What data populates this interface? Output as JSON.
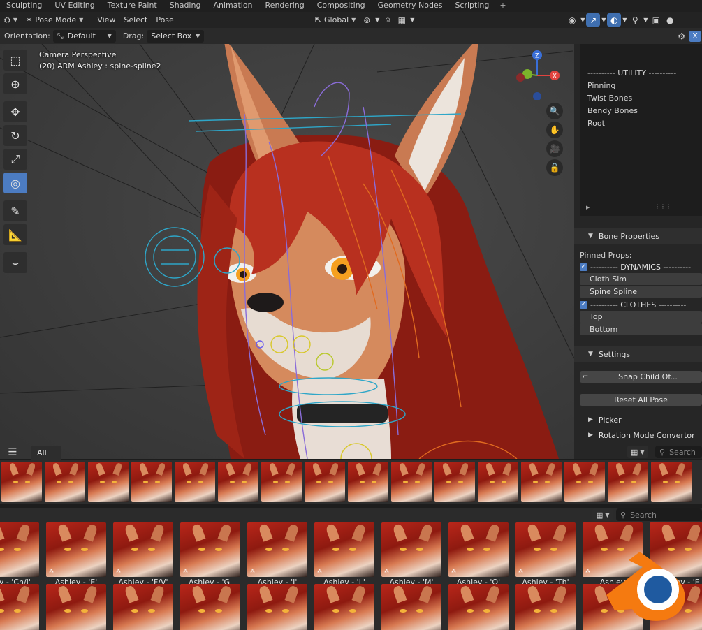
{
  "workspace_tabs": [
    "Sculpting",
    "UV Editing",
    "Texture Paint",
    "Shading",
    "Animation",
    "Rendering",
    "Compositing",
    "Geometry Nodes",
    "Scripting"
  ],
  "header": {
    "mode": "Pose Mode",
    "menus": [
      "View",
      "Select",
      "Pose"
    ],
    "transform_orientation": "Global"
  },
  "tool_settings": {
    "orientation_label": "Orientation:",
    "orientation_value": "Default",
    "drag_label": "Drag:",
    "drag_value": "Select Box"
  },
  "viewport": {
    "info_line1": "Camera Perspective",
    "info_line2": "(20) ARM Ashley : spine-spline2",
    "gizmo_axes": {
      "x": "X",
      "y": "",
      "z": "Z"
    },
    "colors": {
      "x": "#e0433f",
      "y": "#7cb32b",
      "z": "#3a6fd8"
    }
  },
  "n_panel": {
    "list_rows": [
      "---------- UTILITY ----------",
      "Pinning",
      "Twist Bones",
      "Bendy Bones",
      "Root"
    ],
    "bone_properties_title": "Bone Properties",
    "pinned_props_label": "Pinned Props:",
    "dynamics_header": "---------- DYNAMICS ----------",
    "dynamics_items": [
      "Cloth Sim",
      "Spine Spline"
    ],
    "clothes_header": "---------- CLOTHES ----------",
    "clothes_items": [
      "Top",
      "Bottom"
    ],
    "settings_title": "Settings",
    "snap_child_button": "Snap Child Of...",
    "reset_pose_button": "Reset All Pose",
    "picker_title": "Picker",
    "rotation_title": "Rotation Mode Convertor"
  },
  "asset_browser_top": {
    "tab_all": "All",
    "search_placeholder": "Search"
  },
  "asset_browser_bottom": {
    "search_placeholder": "Search",
    "labels": [
      "hley - 'Ch/J'",
      "Ashley - 'E'",
      "Ashley - 'F/V'",
      "Ashley - 'G'",
      "Ashley - 'I'",
      "Ashley - 'L'",
      "Ashley - 'M'",
      "Ashley - 'O'",
      "Ashley - 'Th'",
      "Ashley",
      "Ashley - 'E"
    ]
  },
  "accent_color": "#4c7cc2"
}
